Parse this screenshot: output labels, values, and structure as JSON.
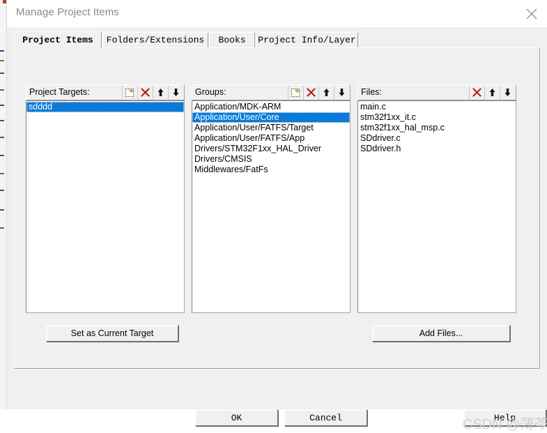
{
  "window": {
    "title": "Manage Project Items",
    "close_icon": "close-icon"
  },
  "tabs": [
    {
      "label": "Project Items",
      "active": true
    },
    {
      "label": "Folders/Extensions",
      "active": false
    },
    {
      "label": "Books",
      "active": false
    },
    {
      "label": "Project Info/Layer",
      "active": false
    }
  ],
  "columns": {
    "targets": {
      "label": "Project Targets:",
      "icons": [
        "new-item-icon",
        "delete-icon",
        "move-up-icon",
        "move-down-icon"
      ],
      "items": [
        "sdddd"
      ],
      "selected_index": 0
    },
    "groups": {
      "label": "Groups:",
      "icons": [
        "new-item-icon",
        "delete-icon",
        "move-up-icon",
        "move-down-icon"
      ],
      "items": [
        "Application/MDK-ARM",
        "Application/User/Core",
        "Application/User/FATFS/Target",
        "Application/User/FATFS/App",
        "Drivers/STM32F1xx_HAL_Driver",
        "Drivers/CMSIS",
        "Middlewares/FatFs"
      ],
      "selected_index": 1
    },
    "files": {
      "label": "Files:",
      "icons": [
        "delete-icon",
        "move-up-icon",
        "move-down-icon"
      ],
      "items": [
        "main.c",
        "stm32f1xx_it.c",
        "stm32f1xx_hal_msp.c",
        "SDdriver.c",
        "SDdriver.h"
      ],
      "selected_index": -1
    }
  },
  "buttons": {
    "set_as_current_target": "Set as Current Target",
    "add_files": "Add Files...",
    "ok": "OK",
    "cancel": "Cancel",
    "help": "Help"
  },
  "watermark": "CSDN @薄芩",
  "colors": {
    "selection_blue": "#0b7ad6",
    "dialog_face": "#f0f0f0",
    "titlebar": "#ffffff",
    "title_text": "#8a8a8a",
    "delete_red": "#b51a1a",
    "watermark_gray": "#d0d0d0"
  }
}
